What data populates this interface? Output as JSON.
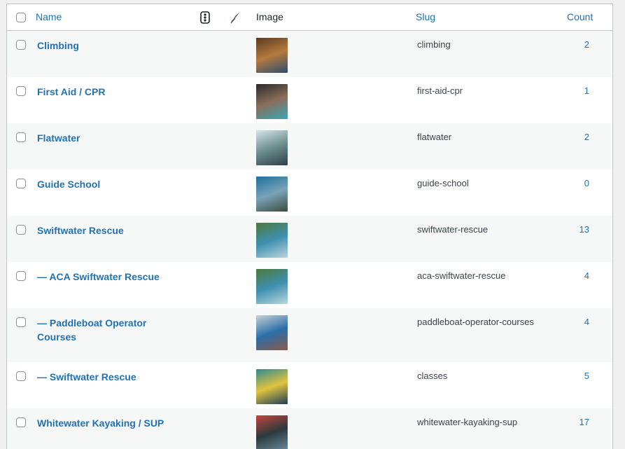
{
  "columns": {
    "name": "Name",
    "image": "Image",
    "slug": "Slug",
    "count": "Count",
    "icon1": "traffic-light-icon",
    "icon2": "feather-icon"
  },
  "rows": [
    {
      "name": "Climbing",
      "slug": "climbing",
      "count": "2",
      "thumb_colors": [
        "#5b3a22",
        "#b57a3e",
        "#2c4d6e"
      ]
    },
    {
      "name": "First Aid / CPR",
      "slug": "first-aid-cpr",
      "count": "1",
      "thumb_colors": [
        "#2a2a2a",
        "#8b6d5a",
        "#3aa6b5"
      ]
    },
    {
      "name": "Flatwater",
      "slug": "flatwater",
      "count": "2",
      "thumb_colors": [
        "#d7e4ea",
        "#6d8f8e",
        "#2e3f48"
      ]
    },
    {
      "name": "Guide School",
      "slug": "guide-school",
      "count": "0",
      "thumb_colors": [
        "#1d6f9c",
        "#7aa3b8",
        "#3b4a3f"
      ]
    },
    {
      "name": "Swiftwater Rescue",
      "slug": "swiftwater-rescue",
      "count": "13",
      "thumb_colors": [
        "#4c7a3a",
        "#3f8fb0",
        "#b9d6de"
      ]
    },
    {
      "name": "— ACA Swiftwater Rescue",
      "slug": "aca-swiftwater-rescue",
      "count": "4",
      "thumb_colors": [
        "#4c7a3a",
        "#3f8fb0",
        "#b9d6de"
      ]
    },
    {
      "name": "— Paddleboat Operator Courses",
      "slug": "paddleboat-operator-courses",
      "count": "4",
      "thumb_colors": [
        "#c9d2d6",
        "#2b6fa8",
        "#8a5a4a"
      ]
    },
    {
      "name": "— Swiftwater Rescue",
      "slug": "classes",
      "count": "5",
      "thumb_colors": [
        "#2f8a8f",
        "#e0c340",
        "#1d3f55"
      ]
    },
    {
      "name": "Whitewater Kayaking / SUP",
      "slug": "whitewater-kayaking-sup",
      "count": "17",
      "thumb_colors": [
        "#c2463b",
        "#2d3a3e",
        "#6a8a9c"
      ]
    }
  ]
}
